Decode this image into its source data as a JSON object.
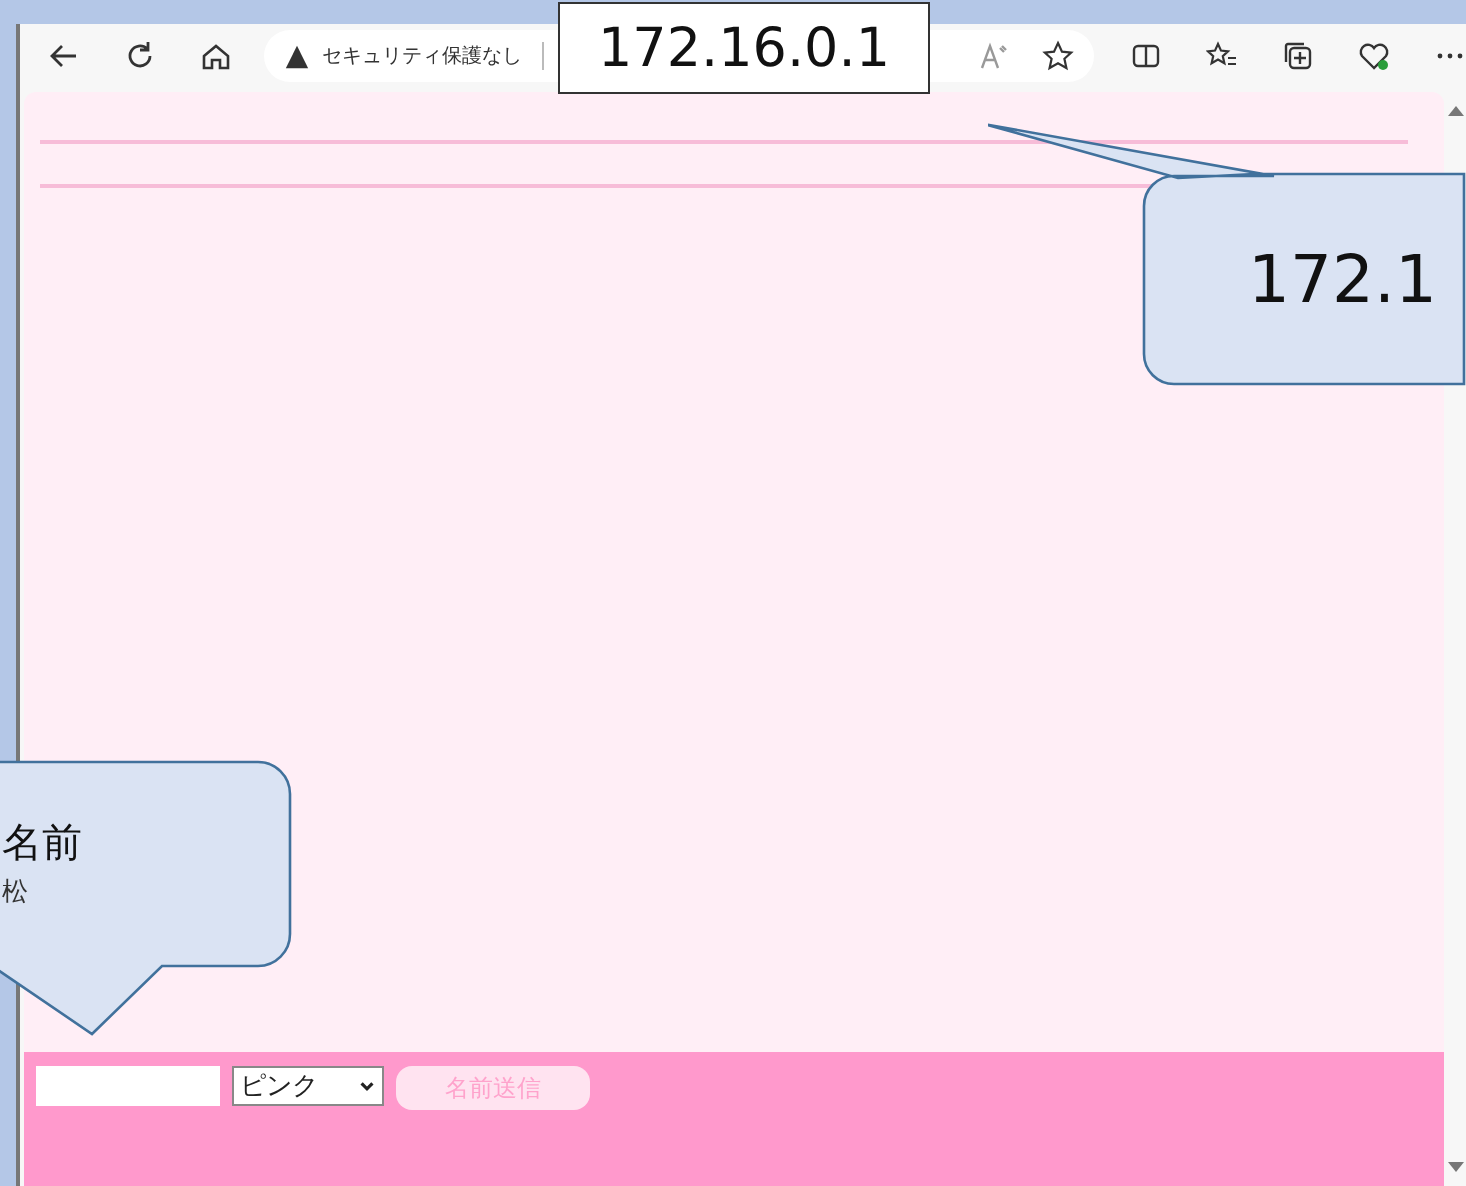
{
  "browser": {
    "security_label": "セキュリティ保護なし"
  },
  "form": {
    "color_select": "ピンク",
    "submit_button": "名前送信"
  },
  "annotations": [
    {
      "kind": "label",
      "text": "172.16.0.1"
    },
    {
      "kind": "callout_right",
      "text": "172.1"
    },
    {
      "kind": "callout_left",
      "title": "名前",
      "subtitle": "松"
    }
  ]
}
